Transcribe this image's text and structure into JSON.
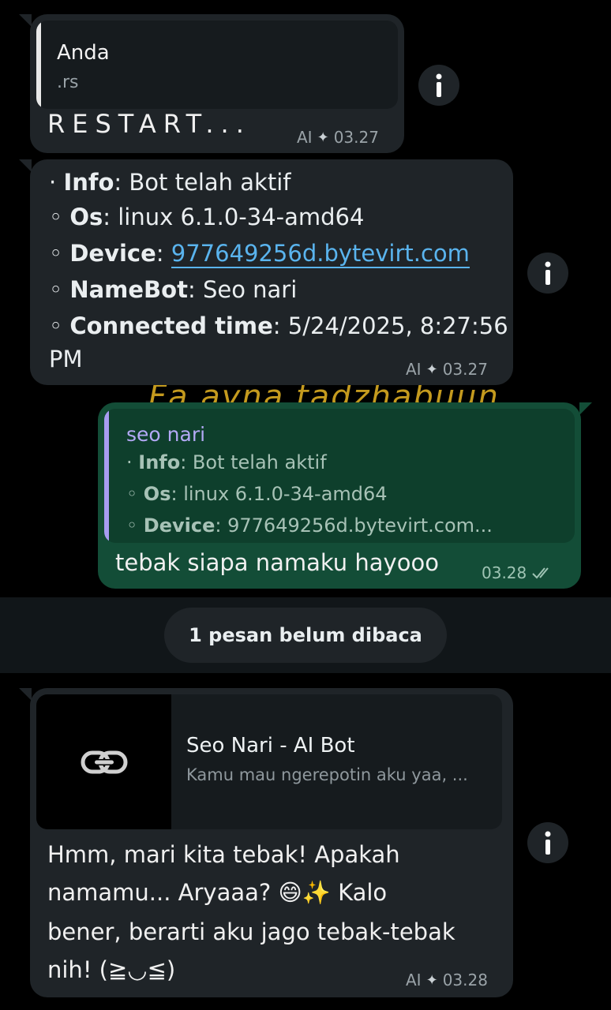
{
  "background_title": "Fa ayna tadzhabuun",
  "msg1": {
    "quote_author": "Anda",
    "quote_text": ".rs",
    "text": "RESTART...",
    "ai_label": "AI",
    "time": "03.27"
  },
  "msg2": {
    "info_key": "Info",
    "info_val": ": Bot telah aktif",
    "os_key": "Os",
    "os_val": ": linux 6.1.0-34-amd64",
    "device_key": "Device",
    "device_val": "977649256d.bytevirt.com",
    "namebot_key": "NameBot",
    "namebot_val": ": Seo nari",
    "connected_key": "Connected time",
    "connected_val": ": 5/24/2025, 8:27:56",
    "connected_val2": "PM",
    "ai_label": "AI",
    "time": "03.27"
  },
  "msg3": {
    "quote_author": "seo nari",
    "quote_info_key": "Info",
    "quote_info_val": ": Bot telah aktif",
    "quote_os_key": "Os",
    "quote_os_val": ": linux 6.1.0-34-amd64",
    "quote_device_key": "Device",
    "quote_device_val": ": 977649256d.bytevirt.com...",
    "text": "tebak siapa namaku hayooo",
    "time": "03.28",
    "status": "read"
  },
  "unread": {
    "label": "1 pesan belum dibaca"
  },
  "msg4": {
    "preview_title": "Seo Nari - AI Bot",
    "preview_desc": "Kamu mau ngerepotin aku yaa, ...",
    "text_line1": "Hmm, mari kita tebak! Apakah",
    "text_line2a": "namamu... Aryaaa? ",
    "text_line2b": " Kalo",
    "text_line3": "bener, berarti aku jago tebak-tebak",
    "text_line4": "nih! (≧◡≦)",
    "emoji1": "😄",
    "emoji2": "✨",
    "ai_label": "AI",
    "time": "03.28"
  },
  "colors": {
    "incoming_bubble": "#1f2428",
    "outgoing_bubble": "#134d37",
    "link": "#5ab4ee",
    "quote_bar_out": "#a79cf2"
  },
  "icons": {
    "info": "info-icon",
    "ai_spark": "sparkle-icon",
    "read_ticks": "double-check-icon",
    "link": "link-icon"
  }
}
